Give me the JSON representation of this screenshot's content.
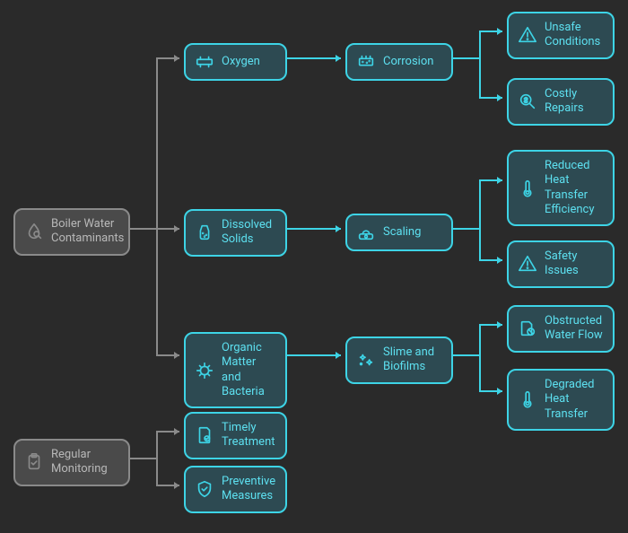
{
  "nodes": {
    "root1": "Boiler Water Contaminants",
    "root2": "Regular Monitoring",
    "oxygen": "Oxygen",
    "dissolved": "Dissolved Solids",
    "organic": "Organic Matter and Bacteria",
    "timely": "Timely Treatment",
    "preventive": "Preventive Measures",
    "corrosion": "Corrosion",
    "scaling": "Scaling",
    "slime": "Slime and Biofilms",
    "unsafe": "Unsafe Conditions",
    "costly": "Costly Repairs",
    "reduced": "Reduced Heat Transfer Efficiency",
    "safety": "Safety Issues",
    "obstructed": "Obstructed Water Flow",
    "degraded": "Degraded Heat Transfer"
  }
}
